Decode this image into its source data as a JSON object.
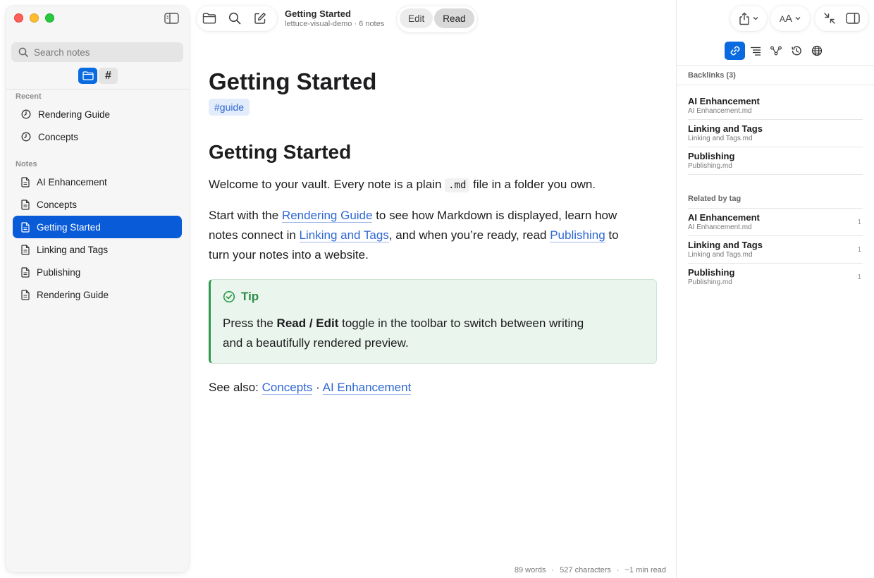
{
  "sidebar": {
    "search_placeholder": "Search notes",
    "recent_label": "Recent",
    "recent": [
      {
        "label": "Rendering Guide"
      },
      {
        "label": "Concepts"
      }
    ],
    "notes_label": "Notes",
    "notes": [
      {
        "label": "AI Enhancement"
      },
      {
        "label": "Concepts"
      },
      {
        "label": "Getting Started",
        "selected": true
      },
      {
        "label": "Linking and Tags"
      },
      {
        "label": "Publishing"
      },
      {
        "label": "Rendering Guide"
      }
    ],
    "hash_label": "#"
  },
  "toolbar": {
    "title": "Getting Started",
    "subtitle": "lettuce-visual-demo · 6 notes",
    "edit_label": "Edit",
    "read_label": "Read",
    "active_mode": "Read"
  },
  "doc": {
    "h1": "Getting Started",
    "tag": "#guide",
    "h2": "Getting Started",
    "p1_a": "Welcome to your vault. Every note is a plain ",
    "p1_code": ".md",
    "p1_b": " file in a folder you own.",
    "p2_a": "Start with the ",
    "p2_link1": "Rendering Guide",
    "p2_b": " to see how Markdown is displayed, learn how notes connect in ",
    "p2_link2": "Linking and Tags",
    "p2_c": ", and when you’re ready, read ",
    "p2_link3": "Publishing",
    "p2_d": " to turn your notes into a website.",
    "tip_title": "Tip",
    "tip_a": "Press the ",
    "tip_bold": "Read / Edit",
    "tip_b": " toggle in the toolbar to switch between writing and a beautifully rendered preview.",
    "see_also": "See also: ",
    "see_link1": "Concepts",
    "see_sep": " · ",
    "see_link2": "AI Enhancement"
  },
  "status": {
    "words": "89 words",
    "characters": "527 characters",
    "read_time": "~1 min read",
    "sep": "·"
  },
  "right_panel": {
    "font_label": "AA",
    "backlinks_label": "Backlinks (3)",
    "backlinks": [
      {
        "title": "AI Enhancement",
        "file": "AI Enhancement.md"
      },
      {
        "title": "Linking and Tags",
        "file": "Linking and Tags.md"
      },
      {
        "title": "Publishing",
        "file": "Publishing.md"
      }
    ],
    "related_label": "Related by tag",
    "related": [
      {
        "title": "AI Enhancement",
        "file": "AI Enhancement.md",
        "count": "1"
      },
      {
        "title": "Linking and Tags",
        "file": "Linking and Tags.md",
        "count": "1"
      },
      {
        "title": "Publishing",
        "file": "Publishing.md",
        "count": "1"
      }
    ]
  },
  "colors": {
    "accent": "#0a5bd8",
    "link": "#2f67d3",
    "tip_green": "#2e9a4d"
  }
}
